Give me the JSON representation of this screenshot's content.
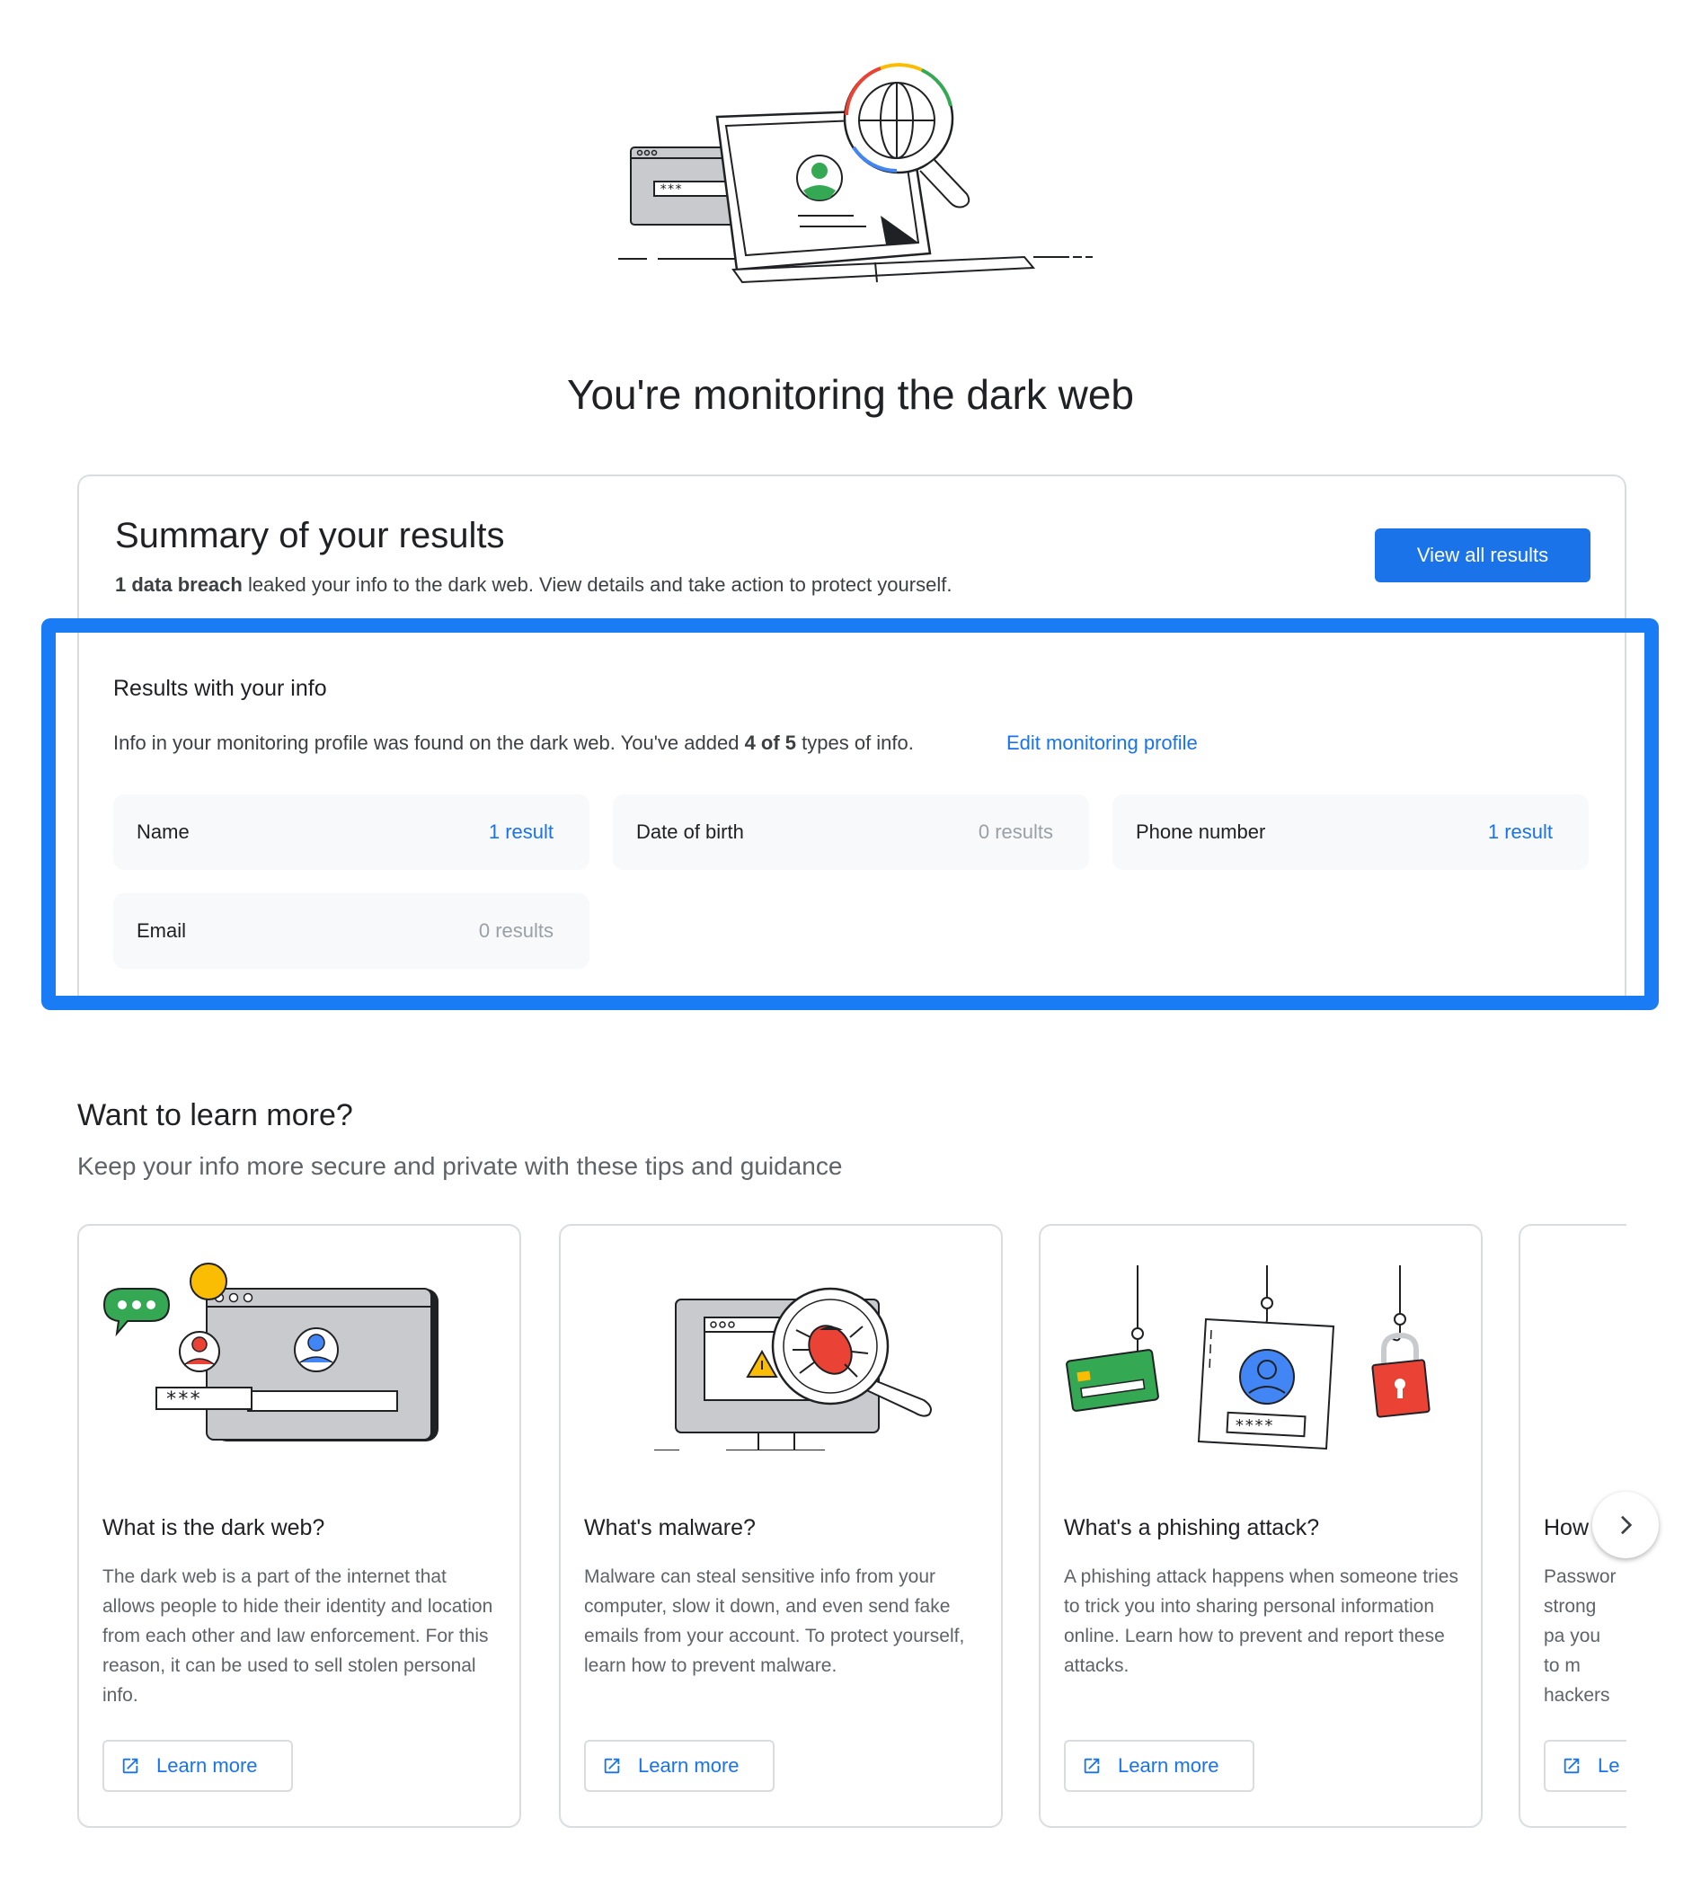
{
  "page_title": "You're monitoring the dark web",
  "summary": {
    "title": "Summary of your results",
    "breach_count": "1 data breach",
    "breach_text": " leaked your info to the dark web. View details and take action to protect yourself.",
    "view_button": "View all results"
  },
  "results_info": {
    "title": "Results with your info",
    "text_prefix": "Info in your monitoring profile was found on the dark web. You've added ",
    "added_count": "4 of 5",
    "text_suffix": " types of info.",
    "edit_link": "Edit monitoring profile",
    "tiles": [
      {
        "label": "Name",
        "result": "1 result"
      },
      {
        "label": "Date of birth",
        "result": "0 results"
      },
      {
        "label": "Phone number",
        "result": "1 result"
      },
      {
        "label": "Email",
        "result": "0 results"
      }
    ]
  },
  "learn": {
    "title": "Want to learn more?",
    "subtitle": "Keep your info more secure and private with these tips and guidance",
    "cards": [
      {
        "title": "What is the dark web?",
        "body": "The dark web is a part of the internet that allows people to hide their identity and location from each other and law enforcement. For this reason, it can be used to sell stolen personal info.",
        "button": "Learn more"
      },
      {
        "title": "What's malware?",
        "body": "Malware can steal sensitive info from your computer, slow it down, and even send fake emails from your account. To protect yourself, learn how to prevent malware.",
        "button": "Learn more"
      },
      {
        "title": "What's a phishing attack?",
        "body": "A phishing attack happens when someone tries to trick you into sharing personal information online. Learn how to prevent and report these attacks.",
        "button": "Learn more"
      },
      {
        "title": "How",
        "body": "Passwor strong pa you to m hackers",
        "button": "Le"
      }
    ]
  },
  "colors": {
    "accent": "#1a73e8",
    "highlight": "#1a7cf5",
    "green": "#34a853",
    "red": "#ea4335",
    "yellow": "#fbbc04"
  },
  "icons": {
    "external": "open-in-new-icon",
    "next": "chevron-right-icon"
  }
}
